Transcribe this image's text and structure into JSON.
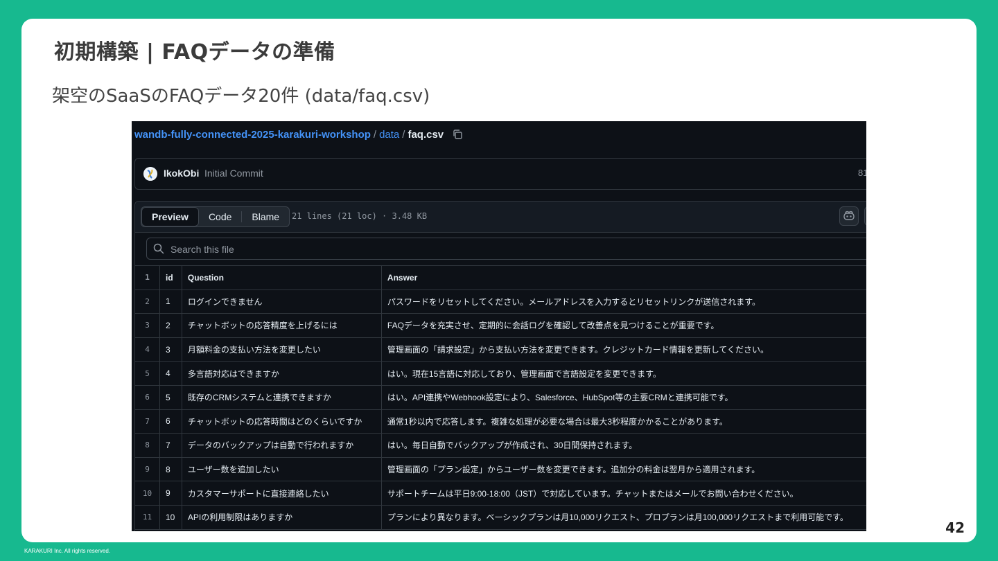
{
  "slide": {
    "title": "初期構築 | FAQデータの準備",
    "subtitle": "架空のSaaSのFAQデータ20件 (data/faq.csv)",
    "page_number": "42",
    "footer": "KARAKURI Inc. All rights reserved."
  },
  "breadcrumb": {
    "repo": "wandb-fully-connected-2025-karakuri-workshop",
    "sep1": "/",
    "folder": "data",
    "sep2": "/",
    "file": "faq.csv"
  },
  "commit": {
    "author": "IkokObi",
    "message": "Initial Commit",
    "hash_partial": "81"
  },
  "file_header": {
    "tabs": [
      "Preview",
      "Code",
      "Blame"
    ],
    "active_tab": "Preview",
    "meta": "21 lines (21 loc) · 3.48 KB"
  },
  "search": {
    "placeholder": "Search this file"
  },
  "table": {
    "headers": {
      "line": "1",
      "id": "id",
      "question": "Question",
      "answer": "Answer"
    },
    "rows": [
      {
        "line": "2",
        "id": "1",
        "question": "ログインできません",
        "answer": "パスワードをリセットしてください。メールアドレスを入力するとリセットリンクが送信されます。"
      },
      {
        "line": "3",
        "id": "2",
        "question": "チャットボットの応答精度を上げるには",
        "answer": "FAQデータを充実させ、定期的に会話ログを確認して改善点を見つけることが重要です。"
      },
      {
        "line": "4",
        "id": "3",
        "question": "月額料金の支払い方法を変更したい",
        "answer": "管理画面の「請求設定」から支払い方法を変更できます。クレジットカード情報を更新してください。"
      },
      {
        "line": "5",
        "id": "4",
        "question": "多言語対応はできますか",
        "answer": "はい。現在15言語に対応しており、管理画面で言語設定を変更できます。"
      },
      {
        "line": "6",
        "id": "5",
        "question": "既存のCRMシステムと連携できますか",
        "answer": "はい。API連携やWebhook設定により、Salesforce、HubSpot等の主要CRMと連携可能です。"
      },
      {
        "line": "7",
        "id": "6",
        "question": "チャットボットの応答時間はどのくらいですか",
        "answer": "通常1秒以内で応答します。複雑な処理が必要な場合は最大3秒程度かかることがあります。"
      },
      {
        "line": "8",
        "id": "7",
        "question": "データのバックアップは自動で行われますか",
        "answer": "はい。毎日自動でバックアップが作成され、30日間保持されます。"
      },
      {
        "line": "9",
        "id": "8",
        "question": "ユーザー数を追加したい",
        "answer": "管理画面の「プラン設定」からユーザー数を変更できます。追加分の料金は翌月から適用されます。"
      },
      {
        "line": "10",
        "id": "9",
        "question": "カスタマーサポートに直接連絡したい",
        "answer": "サポートチームは平日9:00-18:00（JST）で対応しています。チャットまたはメールでお問い合わせください。"
      },
      {
        "line": "11",
        "id": "10",
        "question": "APIの利用制限はありますか",
        "answer": "プランにより異なります。ベーシックプランは月10,000リクエスト、プロプランは月100,000リクエストまで利用可能です。"
      }
    ]
  },
  "colors": {
    "background": "#17b98f",
    "link": "#4493f8",
    "panel": "#0d1117",
    "border": "#30363d"
  },
  "icons": [
    "copy-icon",
    "copilot-icon",
    "search-icon",
    "avatar"
  ]
}
